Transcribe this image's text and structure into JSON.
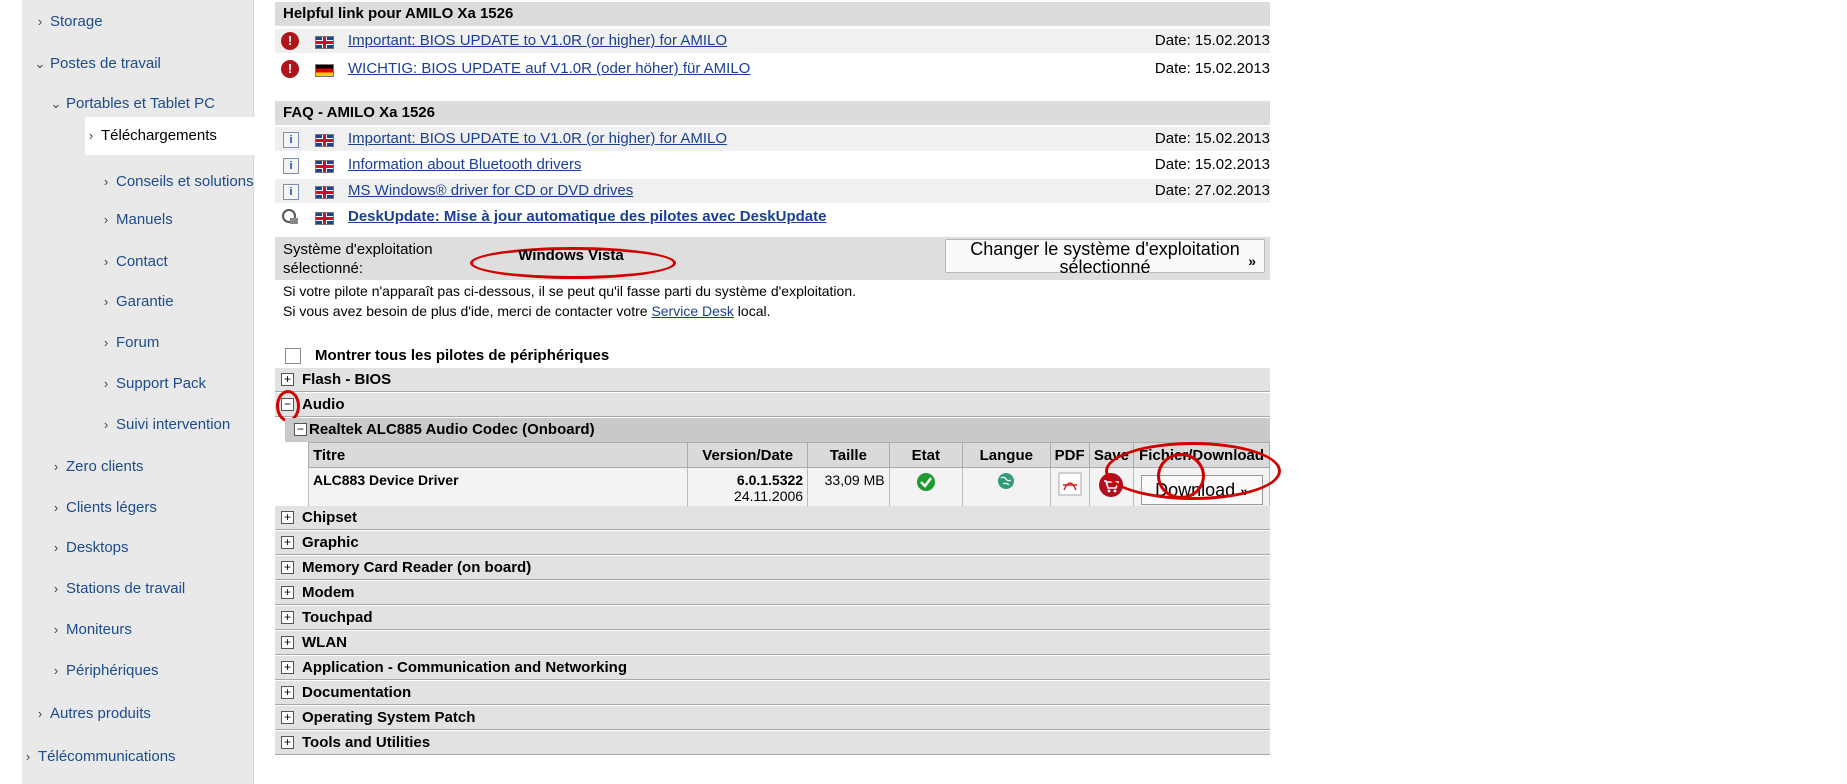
{
  "sidebar": {
    "items": [
      {
        "label": "Storage"
      },
      {
        "label": "Postes de travail"
      },
      {
        "label": "Portables et Tablet PC"
      },
      {
        "label": "Téléchargements"
      },
      {
        "label": "Conseils et solutions"
      },
      {
        "label": "Manuels"
      },
      {
        "label": "Contact"
      },
      {
        "label": "Garantie"
      },
      {
        "label": "Forum"
      },
      {
        "label": "Support Pack"
      },
      {
        "label": "Suivi intervention"
      },
      {
        "label": "Zero clients"
      },
      {
        "label": "Clients légers"
      },
      {
        "label": "Desktops"
      },
      {
        "label": "Stations de travail"
      },
      {
        "label": "Moniteurs"
      },
      {
        "label": "Périphériques"
      },
      {
        "label": "Autres produits"
      },
      {
        "label": "Télécommunications"
      }
    ]
  },
  "helpful": {
    "title": "Helpful link pour AMILO Xa 1526",
    "links": [
      {
        "text": "Important: BIOS UPDATE to V1.0R (or higher) for AMILO",
        "date": "Date: 15.02.2013"
      },
      {
        "text": "WICHTIG: BIOS UPDATE auf V1.0R (oder höher) für AMILO",
        "date": "Date: 15.02.2013"
      }
    ]
  },
  "faq": {
    "title": "FAQ - AMILO Xa 1526",
    "links": [
      {
        "text": "Important: BIOS UPDATE to V1.0R (or higher) for AMILO",
        "date": "Date: 15.02.2013"
      },
      {
        "text": "Information about Bluetooth drivers",
        "date": "Date: 15.02.2013"
      },
      {
        "text": "MS Windows® driver for CD or DVD drives",
        "date": "Date: 27.02.2013"
      }
    ],
    "deskupdate": "DeskUpdate: Mise à jour automatique des pilotes avec DeskUpdate"
  },
  "os": {
    "label": "Système d'exploitation sélectionné:",
    "value": "Windows Vista",
    "change_button": "Changer le système d'exploitation sélectionné",
    "arrows": "»"
  },
  "notes": {
    "line1": "Si votre pilote n'apparaît pas ci-dessous, il se peut qu'il fasse parti du système d'exploitation.",
    "line2_before": "Si vous avez besoin de plus d'ide, merci de contacter votre",
    "line2_link": "Service Desk",
    "line2_after": "local."
  },
  "show_all": "Montrer tous les pilotes de périphériques",
  "toggles": {
    "plus": "+",
    "minus": "−"
  },
  "categories": {
    "flash_bios": "Flash - BIOS",
    "audio": "Audio",
    "audio_sub": "Realtek ALC885 Audio Codec (Onboard)",
    "rest": [
      "Chipset",
      "Graphic",
      "Memory Card Reader (on board)",
      "Modem",
      "Touchpad",
      "WLAN",
      "Application - Communication and Networking",
      "Documentation",
      "Operating System Patch",
      "Tools and Utilities"
    ]
  },
  "driver_table": {
    "headers": {
      "title": "Titre",
      "version": "Version/Date",
      "size": "Taille",
      "state": "Etat",
      "lang": "Langue",
      "pdf": "PDF",
      "save": "Save",
      "file": "Fichier/Download"
    },
    "row": {
      "title": "ALC883 Device Driver",
      "version": "6.0.1.5322",
      "date": "24.11.2006",
      "size": "33,09 MB",
      "download": "Download",
      "arrows": "»"
    }
  },
  "colors": {
    "link": "#1a3f99",
    "annotation": "#d40000",
    "nav_link": "#1d4b8f"
  }
}
